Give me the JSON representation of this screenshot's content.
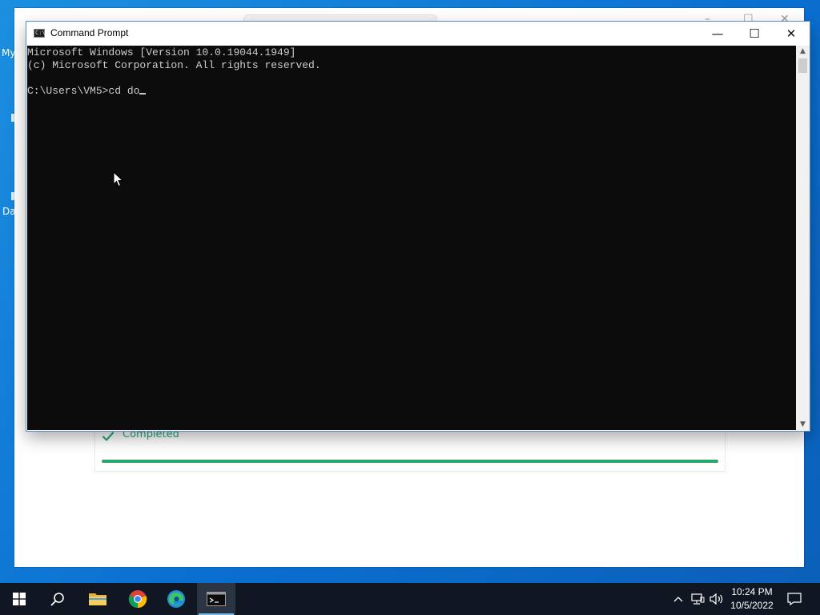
{
  "desktop": {
    "icon_labels": [
      "My",
      "Da"
    ]
  },
  "background_window": {
    "status_label": "Completed",
    "progress": 1.0,
    "colors": {
      "status": "#2aa876",
      "progress": "#27a86f"
    }
  },
  "cmd": {
    "title": "Command Prompt",
    "icon": "console-icon",
    "controls": {
      "minimize": "—",
      "maximize": "☐",
      "close": "✕"
    },
    "lines": [
      "Microsoft Windows [Version 10.0.19044.1949]",
      "(c) Microsoft Corporation. All rights reserved.",
      "",
      "C:\\Users\\VM5>cd do"
    ],
    "colors": {
      "background": "#0c0c0c",
      "text": "#cccccc"
    }
  },
  "taskbar": {
    "items": [
      {
        "name": "start",
        "icon": "windows-logo-icon"
      },
      {
        "name": "search",
        "icon": "search-icon"
      },
      {
        "name": "file-explorer",
        "icon": "folder-icon"
      },
      {
        "name": "chrome",
        "icon": "chrome-icon"
      },
      {
        "name": "edge",
        "icon": "edge-icon"
      },
      {
        "name": "command-prompt",
        "icon": "console-icon",
        "active": true
      }
    ],
    "tray": {
      "icons": [
        "chevron-up-icon",
        "network-icon",
        "volume-icon"
      ],
      "time": "10:24 PM",
      "date": "10/5/2022",
      "notification_icon": "action-center-icon"
    }
  }
}
